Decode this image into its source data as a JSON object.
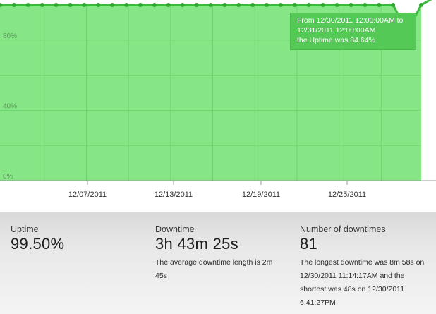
{
  "chart_data": {
    "type": "area",
    "x_ticks": [
      "12/07/2011",
      "12/13/2011",
      "12/19/2011",
      "12/25/2011"
    ],
    "y_ticks": [
      "0%",
      "40%",
      "80%"
    ],
    "ylim": [
      0,
      100
    ],
    "series": [
      {
        "values": [
          100,
          100,
          100,
          100,
          100,
          100,
          100,
          100,
          100,
          100,
          100,
          100,
          100,
          100,
          100,
          100,
          100,
          100,
          100,
          100,
          100,
          100,
          100,
          100,
          100,
          100,
          100,
          100,
          100,
          84.64,
          100
        ]
      }
    ],
    "fill_color": "#86e686",
    "line_color": "#3bbb3b",
    "grid": true
  },
  "tooltip": {
    "line1": "From 12/30/2011 12:00:00AM to",
    "line2": "12/31/2011 12:00:00AM",
    "line3": "the Uptime was 84.64%"
  },
  "stats": {
    "uptime": {
      "label": "Uptime",
      "value": "99.50%"
    },
    "downtime": {
      "label": "Downtime",
      "value": "3h 43m 25s",
      "desc": "The average downtime length is 2m 45s"
    },
    "count": {
      "label": "Number of downtimes",
      "value": "81",
      "desc": "The longest downtime was 8m 58s on 12/30/2011 11:14:17AM and the shortest was 48s on 12/30/2011 6:41:27PM"
    }
  }
}
